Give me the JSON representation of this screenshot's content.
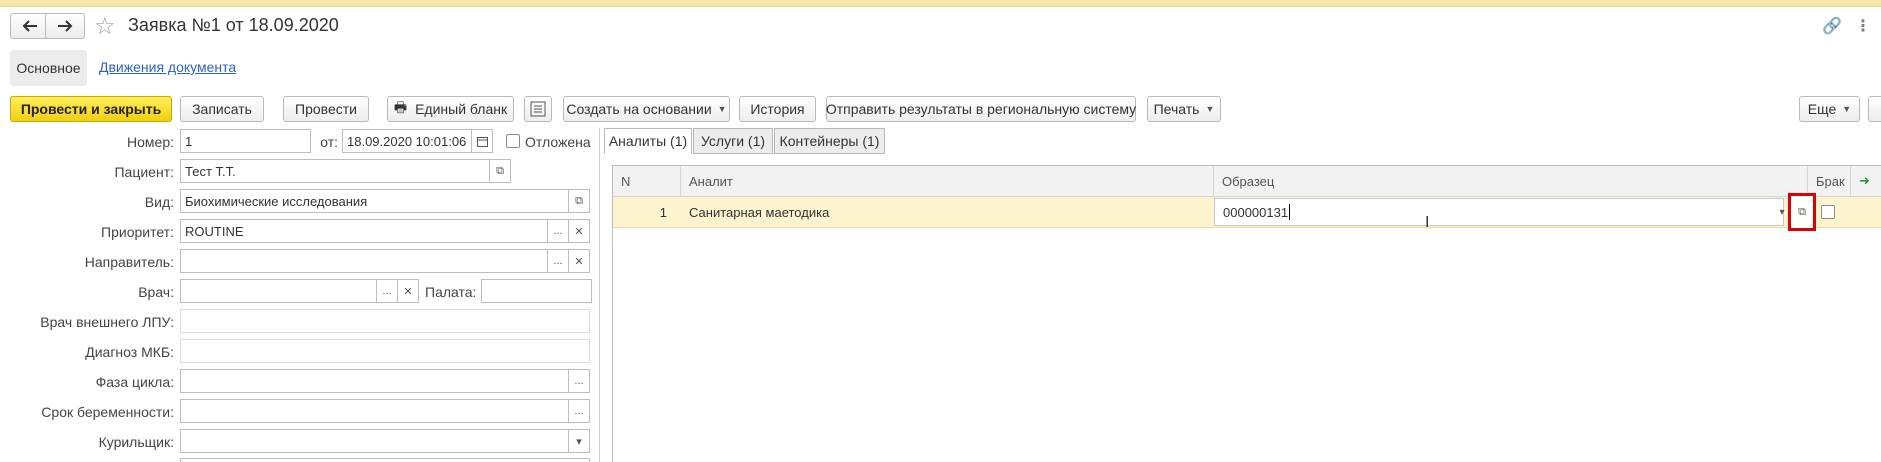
{
  "window": {
    "title": "Заявка №1 от 18.09.2020"
  },
  "tabs": {
    "main": "Основное",
    "movements": "Движения документа"
  },
  "toolbar": {
    "post_close": "Провести и закрыть",
    "save": "Записать",
    "post": "Провести",
    "single_form": "Единый бланк",
    "create_based": "Создать на основании",
    "history": "История",
    "send_results": "Отправить результаты в региональную систему",
    "print": "Печать",
    "more": "Еще"
  },
  "form": {
    "number_label": "Номер:",
    "number_value": "1",
    "from_label": "от:",
    "date_value": "18.09.2020 10:01:06",
    "postponed_label": "Отложена",
    "patient_label": "Пациент:",
    "patient_value": "Тест Т.Т.",
    "kind_label": "Вид:",
    "kind_value": "Биохимические исследования",
    "priority_label": "Приоритет:",
    "priority_value": "ROUTINE",
    "referrer_label": "Направитель:",
    "referrer_value": "",
    "doctor_label": "Врач:",
    "doctor_value": "",
    "ward_label": "Палата:",
    "ward_value": "",
    "ext_doctor_label": "Врач внешнего ЛПУ:",
    "ext_doctor_value": "",
    "diagnosis_label": "Диагноз МКБ:",
    "diagnosis_value": "",
    "cycle_label": "Фаза цикла:",
    "cycle_value": "",
    "pregnancy_label": "Срок беременности:",
    "pregnancy_value": "",
    "smoker_label": "Курильщик:",
    "smoker_value": ""
  },
  "right_tabs": {
    "analytes": "Аналиты (1)",
    "services": "Услуги (1)",
    "containers": "Контейнеры (1)"
  },
  "grid": {
    "headers": {
      "n": "N",
      "analyte": "Аналит",
      "sample": "Образец",
      "defect": "Брак"
    },
    "rows": [
      {
        "n": "1",
        "analyte": "Санитарная маетодика",
        "sample": "000000131"
      }
    ]
  },
  "colors": {
    "accent": "#f3cf10",
    "link": "#2d62c7",
    "highlight": "#e00000",
    "row_selected": "#fdf3cf"
  }
}
